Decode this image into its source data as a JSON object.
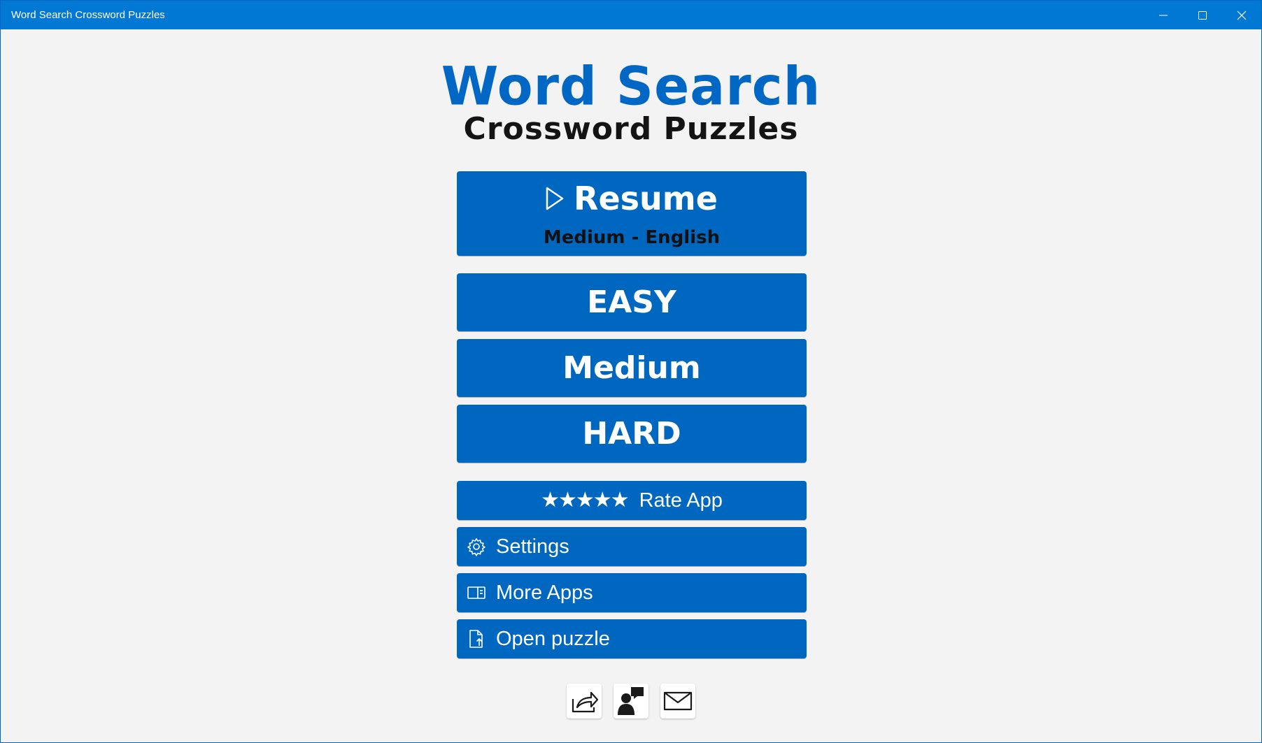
{
  "window": {
    "title": "Word Search Crossword Puzzles",
    "controls": [
      "minimize",
      "maximize",
      "close"
    ]
  },
  "logo": {
    "line1": "Word Search",
    "line2": "Crossword Puzzles"
  },
  "resume": {
    "icon": "play-icon",
    "label": "Resume",
    "sublabel": "Medium - English"
  },
  "levels": [
    {
      "label": "EASY"
    },
    {
      "label": "Medium"
    },
    {
      "label": "HARD"
    }
  ],
  "menu": {
    "rate": {
      "stars": "★★★★★",
      "label": "Rate App"
    },
    "settings": {
      "icon": "gear-icon",
      "label": "Settings"
    },
    "more_apps": {
      "icon": "panel-icon",
      "label": "More Apps"
    },
    "open_puzzle": {
      "icon": "file-upload-icon",
      "label": "Open puzzle"
    }
  },
  "bottom_actions": [
    {
      "icon": "share-icon"
    },
    {
      "icon": "feedback-icon"
    },
    {
      "icon": "mail-icon"
    }
  ],
  "colors": {
    "titlebar": "#0078d4",
    "button": "#0067c0",
    "logo_blue": "#0068c4",
    "logo_dark": "#141414",
    "background": "#f3f3f3"
  }
}
